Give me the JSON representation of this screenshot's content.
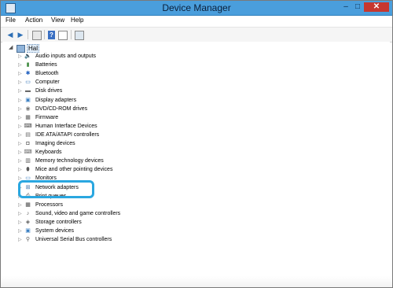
{
  "window": {
    "title": "Device Manager",
    "close_glyph": "✕",
    "min_glyph": "–",
    "max_glyph": "□"
  },
  "menu": [
    "File",
    "Action",
    "View",
    "Help"
  ],
  "toolbar": {
    "back_icon": "back-arrow-icon",
    "forward_icon": "forward-arrow-icon",
    "properties_icon": "properties-icon",
    "help_icon": "help-icon",
    "view_icon": "view-icon",
    "scan_icon": "scan-hardware-icon",
    "back_glyph": "◀",
    "forward_glyph": "▶",
    "help_glyph": "?"
  },
  "tree": {
    "root": {
      "label": "Hal",
      "expand_glyph": "◢"
    },
    "categories": [
      {
        "label": "Audio inputs and outputs",
        "icon": "speaker-icon",
        "glyph": "🔈",
        "color": "#5a5a5a"
      },
      {
        "label": "Batteries",
        "icon": "battery-icon",
        "glyph": "▮",
        "color": "#3f8a3f"
      },
      {
        "label": "Bluetooth",
        "icon": "bluetooth-icon",
        "glyph": "✱",
        "color": "#1f5fbf"
      },
      {
        "label": "Computer",
        "icon": "computer-icon",
        "glyph": "▭",
        "color": "#2d6fb5"
      },
      {
        "label": "Disk drives",
        "icon": "disk-drive-icon",
        "glyph": "▬",
        "color": "#6a6a6a"
      },
      {
        "label": "Display adapters",
        "icon": "display-adapter-icon",
        "glyph": "▣",
        "color": "#3a7fc2"
      },
      {
        "label": "DVD/CD-ROM drives",
        "icon": "dvd-drive-icon",
        "glyph": "◉",
        "color": "#7a7a7a"
      },
      {
        "label": "Firmware",
        "icon": "firmware-icon",
        "glyph": "▦",
        "color": "#5a5a5a"
      },
      {
        "label": "Human Interface Devices",
        "icon": "hid-icon",
        "glyph": "⌨",
        "color": "#4a4a4a"
      },
      {
        "label": "IDE ATA/ATAPI controllers",
        "icon": "ide-controller-icon",
        "glyph": "▤",
        "color": "#6a6a6a"
      },
      {
        "label": "Imaging devices",
        "icon": "camera-icon",
        "glyph": "◘",
        "color": "#4a4a4a"
      },
      {
        "label": "Keyboards",
        "icon": "keyboard-icon",
        "glyph": "⌨",
        "color": "#6a6a6a"
      },
      {
        "label": "Memory technology devices",
        "icon": "memory-icon",
        "glyph": "▥",
        "color": "#5a5a5a"
      },
      {
        "label": "Mice and other pointing devices",
        "icon": "mouse-icon",
        "glyph": "⬮",
        "color": "#5a5a5a"
      },
      {
        "label": "Monitors",
        "icon": "monitor-icon",
        "glyph": "▭",
        "color": "#3a7fc2"
      },
      {
        "label": "Network adapters",
        "icon": "network-adapter-icon",
        "glyph": "⊞",
        "color": "#3a6fa5"
      },
      {
        "label": "Print queues",
        "icon": "printer-icon",
        "glyph": "⎙",
        "color": "#5a5a5a"
      },
      {
        "label": "Processors",
        "icon": "processor-icon",
        "glyph": "▦",
        "color": "#4a4a4a"
      },
      {
        "label": "Sound, video and game controllers",
        "icon": "sound-icon",
        "glyph": "♪",
        "color": "#5a5a5a"
      },
      {
        "label": "Storage controllers",
        "icon": "storage-controller-icon",
        "glyph": "◈",
        "color": "#5a5a5a"
      },
      {
        "label": "System devices",
        "icon": "system-device-icon",
        "glyph": "▣",
        "color": "#3a7fc2"
      },
      {
        "label": "Universal Serial Bus controllers",
        "icon": "usb-icon",
        "glyph": "⚲",
        "color": "#5a5a5a"
      }
    ],
    "collapsed_glyph": "▷"
  },
  "highlight": {
    "target": "Network adapters",
    "color": "#2aa7e0"
  }
}
